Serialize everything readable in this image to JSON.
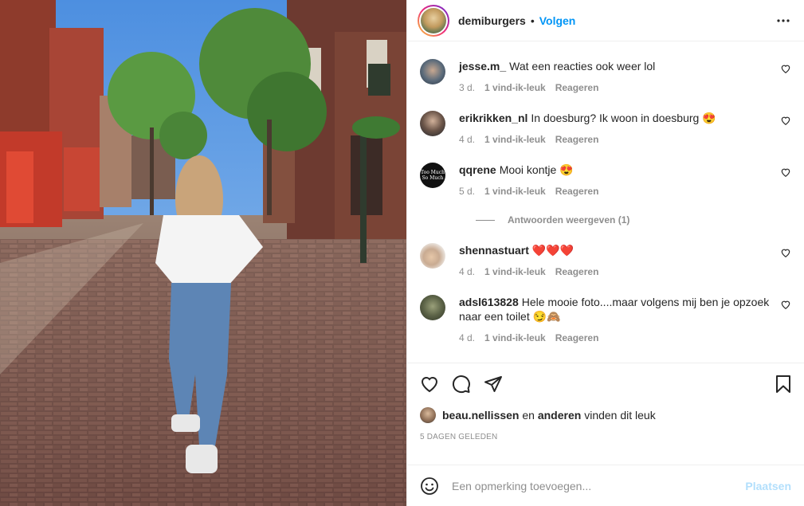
{
  "header": {
    "username": "demiburgers",
    "dot": "•",
    "follow_label": "Volgen"
  },
  "comments": [
    {
      "user": "jesse.m_",
      "text": "Wat een reacties ook weer lol",
      "time": "3 d.",
      "likes": "1 vind-ik-leuk",
      "reply": "Reageren"
    },
    {
      "user": "erikrikken_nl",
      "text": "In doesburg? Ik woon in doesburg 😍",
      "time": "4 d.",
      "likes": "1 vind-ik-leuk",
      "reply": "Reageren"
    },
    {
      "user": "qqrene",
      "text": "Mooi kontje 😍",
      "time": "5 d.",
      "likes": "1 vind-ik-leuk",
      "reply": "Reageren",
      "avatar_text": [
        "Too Much",
        "So Much"
      ]
    },
    {
      "user": "shennastuart",
      "text": "❤️❤️❤️",
      "time": "4 d.",
      "likes": "1 vind-ik-leuk",
      "reply": "Reageren"
    },
    {
      "user": "adsl613828",
      "text": "Hele mooie foto....maar volgens mij ben je opzoek naar een toilet 😏🙈",
      "time": "4 d.",
      "likes": "1 vind-ik-leuk",
      "reply": "Reageren"
    }
  ],
  "replies_toggle": "Antwoorden weergeven (1)",
  "likes": {
    "user": "beau.nellissen",
    "middle": " en ",
    "others": "anderen",
    "suffix": " vinden dit leuk"
  },
  "date": "5 DAGEN GELEDEN",
  "add_comment": {
    "placeholder": "Een opmerking toevoegen...",
    "post_label": "Plaatsen"
  },
  "colors": {
    "accent": "#0095f6",
    "post_disabled": "#b2dffc",
    "muted": "#8e8e8e"
  }
}
